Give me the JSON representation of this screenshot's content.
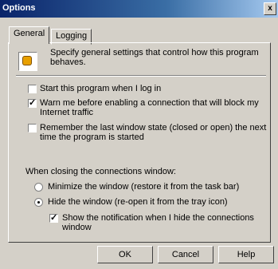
{
  "window": {
    "title": "Options",
    "close": "x"
  },
  "tabs": [
    {
      "label": "General"
    },
    {
      "label": "Logging"
    }
  ],
  "general": {
    "description": "Specify general settings that control how this program behaves.",
    "options": [
      {
        "label": "Start this program when I log in",
        "checked": false
      },
      {
        "label": "Warn me before enabling a connection that will block my Internet traffic",
        "checked": true
      },
      {
        "label": "Remember the last window state (closed or open) the next time the program is started",
        "checked": false
      }
    ],
    "closing_heading": "When closing the connections window:",
    "radios": [
      {
        "label": "Minimize the window (restore it from the task bar)",
        "checked": false
      },
      {
        "label": "Hide the window (re-open it from the tray icon)",
        "checked": true
      }
    ],
    "notify": {
      "label": "Show the notification when I hide the connections window",
      "checked": true
    }
  },
  "buttons": {
    "ok": "OK",
    "cancel": "Cancel",
    "help": "Help"
  }
}
